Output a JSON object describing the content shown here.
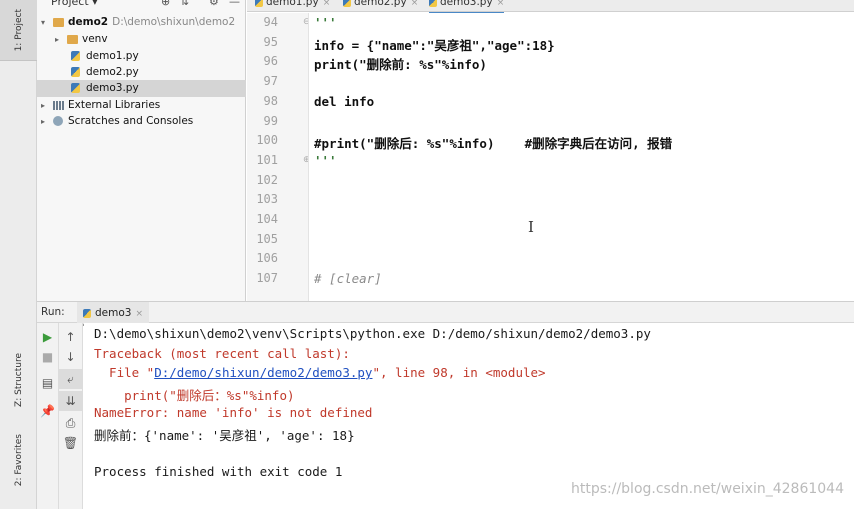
{
  "side_tabs": {
    "project": "1: Project",
    "structure": "Z: Structure",
    "favorites": "2: Favorites"
  },
  "project_panel": {
    "title": "Project",
    "tree": [
      {
        "label": "demo2",
        "path": "D:\\demo\\shixun\\demo2",
        "kind": "folder",
        "expanded": true
      },
      {
        "label": "venv",
        "kind": "folder-excluded",
        "expanded": false
      },
      {
        "label": "demo1.py",
        "kind": "py"
      },
      {
        "label": "demo2.py",
        "kind": "py"
      },
      {
        "label": "demo3.py",
        "kind": "py",
        "selected": true
      },
      {
        "label": "External Libraries",
        "kind": "libraries"
      },
      {
        "label": "Scratches and Consoles",
        "kind": "scratches"
      }
    ]
  },
  "editor_tabs": [
    {
      "label": "demo1.py",
      "close": "×"
    },
    {
      "label": "demo2.py",
      "close": "×"
    },
    {
      "label": "demo3.py",
      "close": "×",
      "active": true
    }
  ],
  "editor": {
    "line_numbers": [
      "94",
      "95",
      "96",
      "97",
      "98",
      "99",
      "100",
      "101",
      "102",
      "103",
      "104",
      "105",
      "106",
      "107"
    ],
    "current_line": "101",
    "lines": [
      {
        "num": "94",
        "text": "'''",
        "style": "docstr"
      },
      {
        "num": "95",
        "text": "info = {\"name\":\"吴彦祖\",\"age\":18}",
        "style": "code"
      },
      {
        "num": "96",
        "text": "print(\"删除前: %s\"%info)",
        "style": "code"
      },
      {
        "num": "97",
        "text": "",
        "style": "code"
      },
      {
        "num": "98",
        "text": "del info",
        "style": "code"
      },
      {
        "num": "99",
        "text": "",
        "style": "code"
      },
      {
        "num": "100",
        "text": "#print(\"删除后: %s\"%info)    #删除字典后在访问, 报错",
        "style": "code"
      },
      {
        "num": "101",
        "text": "'''",
        "style": "docstr"
      },
      {
        "num": "102",
        "text": "",
        "style": "code"
      },
      {
        "num": "103",
        "text": "",
        "style": "code"
      },
      {
        "num": "104",
        "text": "",
        "style": "code"
      },
      {
        "num": "105",
        "text": "",
        "style": "code"
      },
      {
        "num": "106",
        "text": "",
        "style": "code"
      },
      {
        "num": "107",
        "text": "# [clear]",
        "style": "comment"
      }
    ]
  },
  "run_panel": {
    "label": "Run:",
    "tab": "demo3",
    "tab_close": "×",
    "output": [
      {
        "text": "D:\\demo\\shixun\\demo2\\venv\\Scripts\\python.exe D:/demo/shixun/demo2/demo3.py",
        "style": "out"
      },
      {
        "text": "Traceback (most recent call last):",
        "style": "err"
      },
      {
        "prefix": "  File \"",
        "link": "D:/demo/shixun/demo2/demo3.py",
        "suffix": "\", line 98, in <module>",
        "style": "err"
      },
      {
        "text": "    print(\"删除后：%s\"%info)",
        "style": "err"
      },
      {
        "text": "NameError: name 'info' is not defined",
        "style": "err"
      },
      {
        "text": "删除前：{'name': '吴彦祖', 'age': 18}",
        "style": "out"
      },
      {
        "text": "",
        "style": "out"
      },
      {
        "text": "Process finished with exit code 1",
        "style": "out"
      }
    ]
  },
  "watermark": "https://blog.csdn.net/weixin_42861044",
  "colors": {
    "accent": "#4a88c7",
    "error": "#c0392b",
    "link": "#2050c0",
    "current_line": "#fffbe6"
  }
}
